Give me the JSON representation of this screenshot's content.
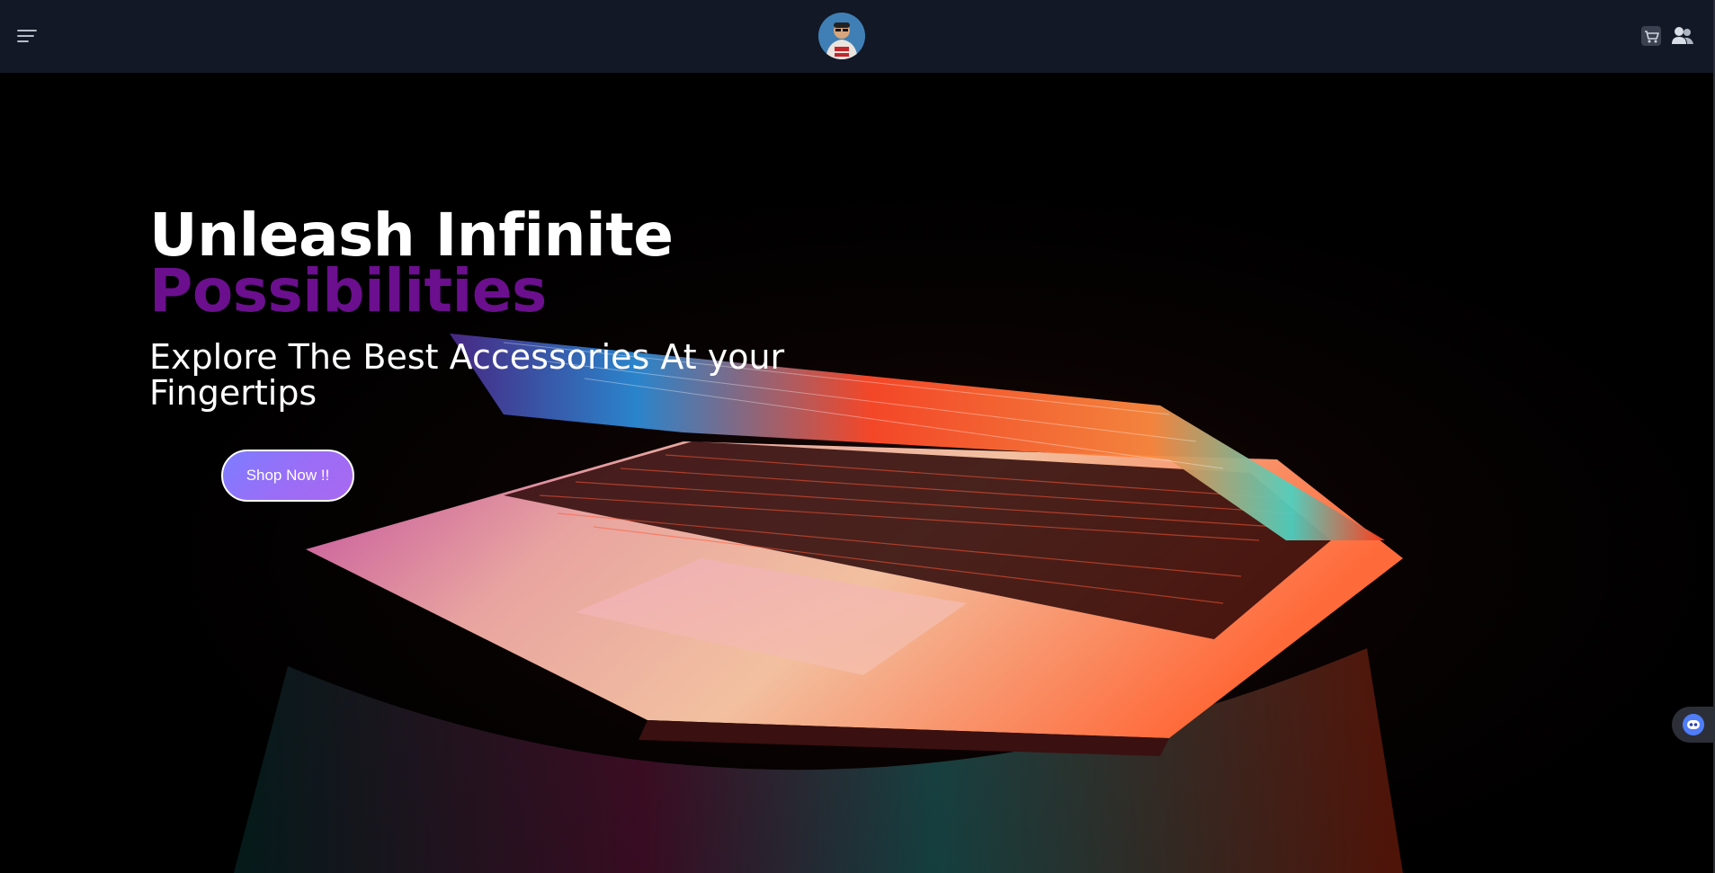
{
  "navbar": {
    "menu_icon": "hamburger-menu-icon",
    "logo_icon": "avatar-logo",
    "cart_icon": "shopping-cart-icon",
    "users_icon": "users-icon",
    "background_color": "#121826"
  },
  "hero": {
    "headline_line1": "Unleash Infinite",
    "headline_line2": "Possibilities",
    "subheadline": "Explore The Best Accessories At your Fingertips",
    "cta_label": "Shop Now !!",
    "accent_color": "#6b0f8e",
    "cta_gradient": [
      "#7d7dff",
      "#a968f0"
    ]
  },
  "chat_widget": {
    "icon": "chatbot-icon"
  }
}
